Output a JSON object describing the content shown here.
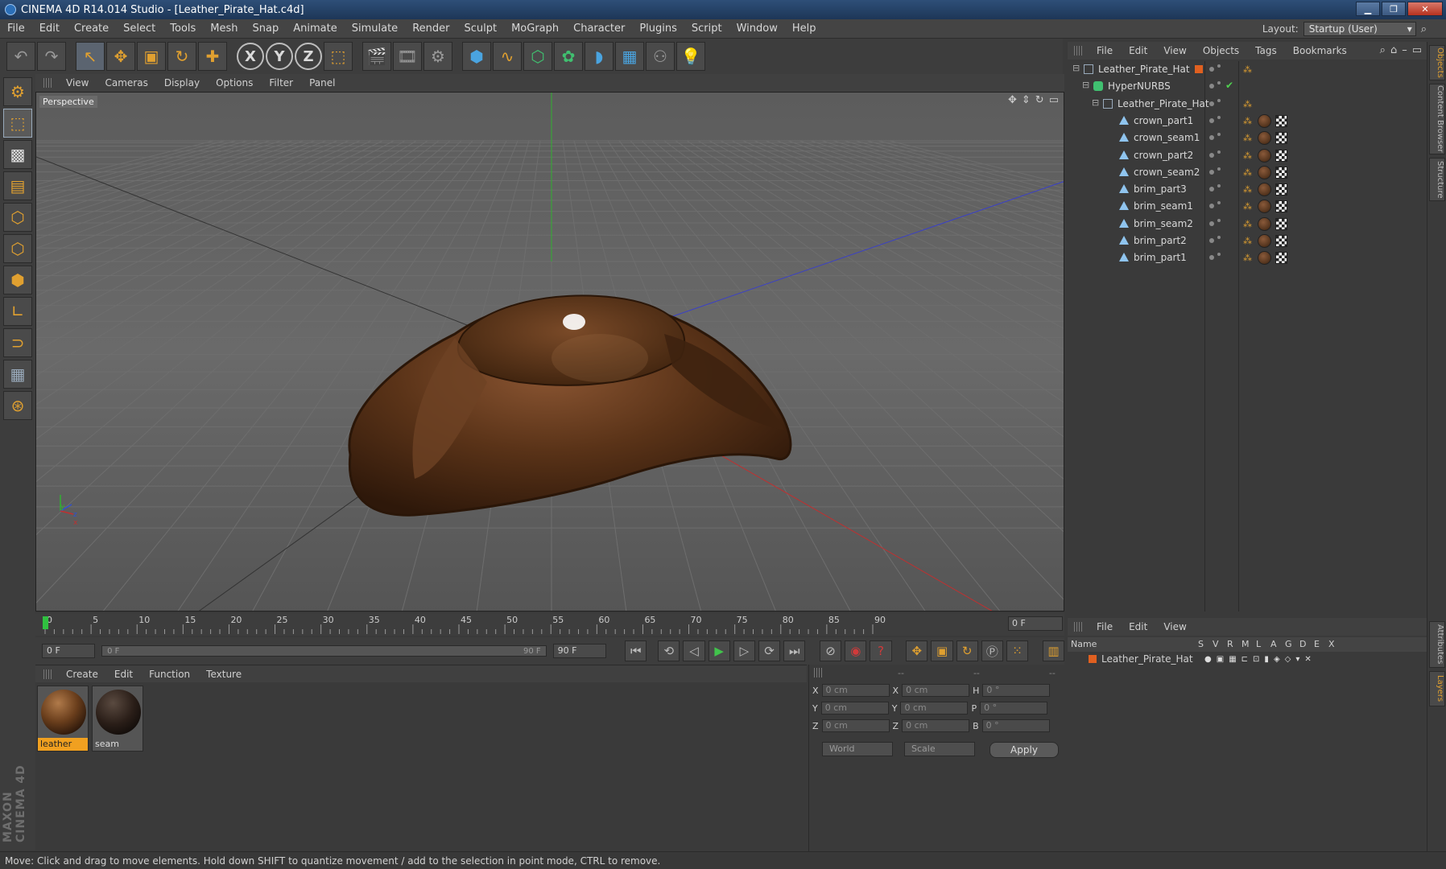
{
  "window": {
    "title": "CINEMA 4D R14.014 Studio - [Leather_Pirate_Hat.c4d]",
    "minimize": "▁",
    "maximize": "❐",
    "close": "✕"
  },
  "menubar": [
    "File",
    "Edit",
    "Create",
    "Select",
    "Tools",
    "Mesh",
    "Snap",
    "Animate",
    "Simulate",
    "Render",
    "Sculpt",
    "MoGraph",
    "Character",
    "Plugins",
    "Script",
    "Window",
    "Help"
  ],
  "layout": {
    "label": "Layout:",
    "value": "Startup (User)"
  },
  "toolbar_icons": [
    "undo-icon",
    "redo-icon",
    "live-selection-icon",
    "move-icon",
    "scale-icon",
    "rotate-icon",
    "create-icon",
    "x-axis-icon",
    "y-axis-icon",
    "z-axis-icon",
    "coordinate-system-icon",
    "render-view-icon",
    "render-picture-viewer-icon",
    "edit-render-settings-icon",
    "cube-icon",
    "spline-icon",
    "nurbs-icon",
    "mograph-icon",
    "deformer-icon",
    "floor-icon",
    "camera-icon",
    "light-icon"
  ],
  "axis_labels": [
    "X",
    "Y",
    "Z"
  ],
  "viewport": {
    "menu": [
      "View",
      "Cameras",
      "Display",
      "Options",
      "Filter",
      "Panel"
    ],
    "label": "Perspective",
    "axes_labels": {
      "y": "y",
      "z": "z",
      "x": "x"
    }
  },
  "timeline": {
    "ticks": [
      "0",
      "5",
      "10",
      "15",
      "20",
      "25",
      "30",
      "35",
      "40",
      "45",
      "50",
      "55",
      "60",
      "65",
      "70",
      "75",
      "80",
      "85",
      "90"
    ],
    "current_frame": "0 F"
  },
  "transport": {
    "start": "0 F",
    "range_start": "0 F",
    "range_end": "90 F",
    "end": "90 F"
  },
  "material_manager": {
    "menu": [
      "Create",
      "Edit",
      "Function",
      "Texture"
    ],
    "materials": [
      {
        "name": "leather",
        "selected": true
      },
      {
        "name": "seam",
        "selected": false
      }
    ]
  },
  "coordinates": {
    "headers": [
      "--",
      "--",
      "--"
    ],
    "rows": [
      {
        "pos_label": "X",
        "pos": "0 cm",
        "size_label": "X",
        "size": "0 cm",
        "rot_label": "H",
        "rot": "0 °"
      },
      {
        "pos_label": "Y",
        "pos": "0 cm",
        "size_label": "Y",
        "size": "0 cm",
        "rot_label": "P",
        "rot": "0 °"
      },
      {
        "pos_label": "Z",
        "pos": "0 cm",
        "size_label": "Z",
        "size": "0 cm",
        "rot_label": "B",
        "rot": "0 °"
      }
    ],
    "world": "World",
    "scale": "Scale",
    "apply": "Apply"
  },
  "object_manager": {
    "menu": [
      "File",
      "Edit",
      "View",
      "Objects",
      "Tags",
      "Bookmarks"
    ],
    "objects": [
      {
        "name": "Leather_Pirate_Hat",
        "level": 0,
        "type": "null"
      },
      {
        "name": "HyperNURBS",
        "level": 1,
        "type": "nurbs"
      },
      {
        "name": "Leather_Pirate_Hat",
        "level": 2,
        "type": "null"
      },
      {
        "name": "crown_part1",
        "level": 3,
        "type": "mesh"
      },
      {
        "name": "crown_seam1",
        "level": 3,
        "type": "mesh"
      },
      {
        "name": "crown_part2",
        "level": 3,
        "type": "mesh"
      },
      {
        "name": "crown_seam2",
        "level": 3,
        "type": "mesh"
      },
      {
        "name": "brim_part3",
        "level": 3,
        "type": "mesh"
      },
      {
        "name": "brim_seam1",
        "level": 3,
        "type": "mesh"
      },
      {
        "name": "brim_seam2",
        "level": 3,
        "type": "mesh"
      },
      {
        "name": "brim_part2",
        "level": 3,
        "type": "mesh"
      },
      {
        "name": "brim_part1",
        "level": 3,
        "type": "mesh"
      }
    ],
    "check_mark": "✔"
  },
  "right_tabs": [
    "Objects",
    "Content Browser",
    "Structure",
    "Attributes",
    "Layers"
  ],
  "layers": {
    "menu": [
      "File",
      "Edit",
      "View"
    ],
    "columns": [
      "Name",
      "S",
      "V",
      "R",
      "M",
      "L",
      "A",
      "G",
      "D",
      "E",
      "X"
    ],
    "rows": [
      {
        "name": "Leather_Pirate_Hat"
      }
    ]
  },
  "branding": "MAXON CINEMA 4D",
  "status": "Move: Click and drag to move elements. Hold down SHIFT to quantize movement / add to the selection in point mode, CTRL to remove.",
  "colors": {
    "accent": "#e0a030",
    "selection": "#f0a020",
    "grid_line": "#6a6a6a",
    "x_axis": "#c03030",
    "y_axis": "#30b030",
    "z_axis": "#3040c0"
  }
}
